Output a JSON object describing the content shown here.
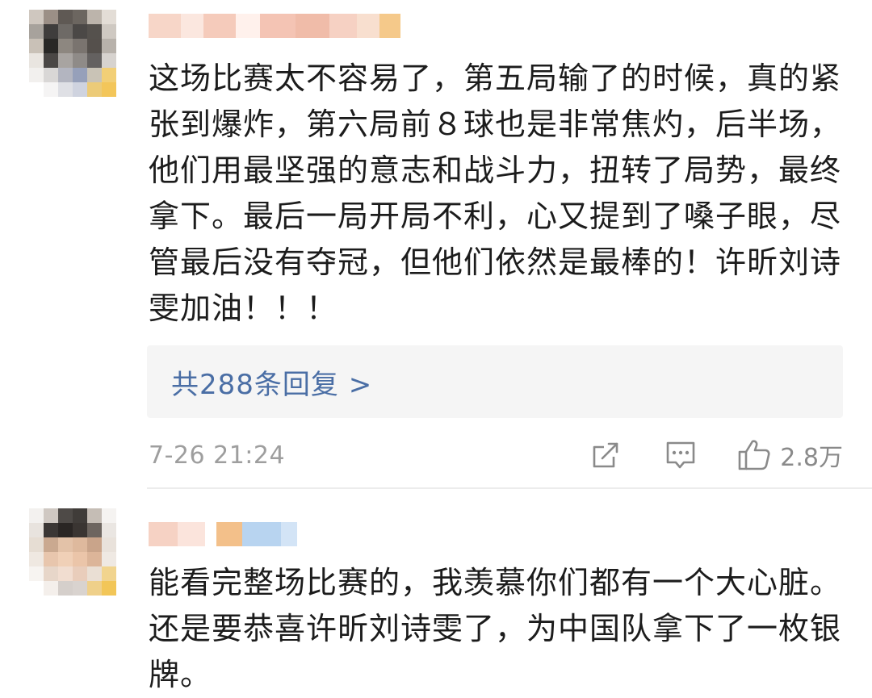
{
  "comments": [
    {
      "text": "这场比赛太不容易了，第五局输了的时候，真的紧张到爆炸，第六局前８球也是非常焦灼，后半场，他们用最坚强的意志和战斗力，扭转了局势，最终拿下。最后一局开局不利，心又提到了嗓子眼，尽管最后没有夺冠，但他们依然是最棒的！许昕刘诗雯加油！！！",
      "replies_label": "共288条回复 >",
      "timestamp": "7-26 21:24",
      "likes": "2.8万",
      "icons": {
        "share": "share-icon",
        "comment": "comment-icon",
        "like": "thumbs-up-icon"
      }
    },
    {
      "text": "能看完整场比赛的，我羡慕你们都有一个大心脏。还是要恭喜许昕刘诗雯了，为中国队拿下了一枚银牌。"
    }
  ],
  "colors": {
    "link": "#4a6ea5",
    "meta": "#9e9e9e",
    "reply_bg": "#f5f5f5"
  }
}
